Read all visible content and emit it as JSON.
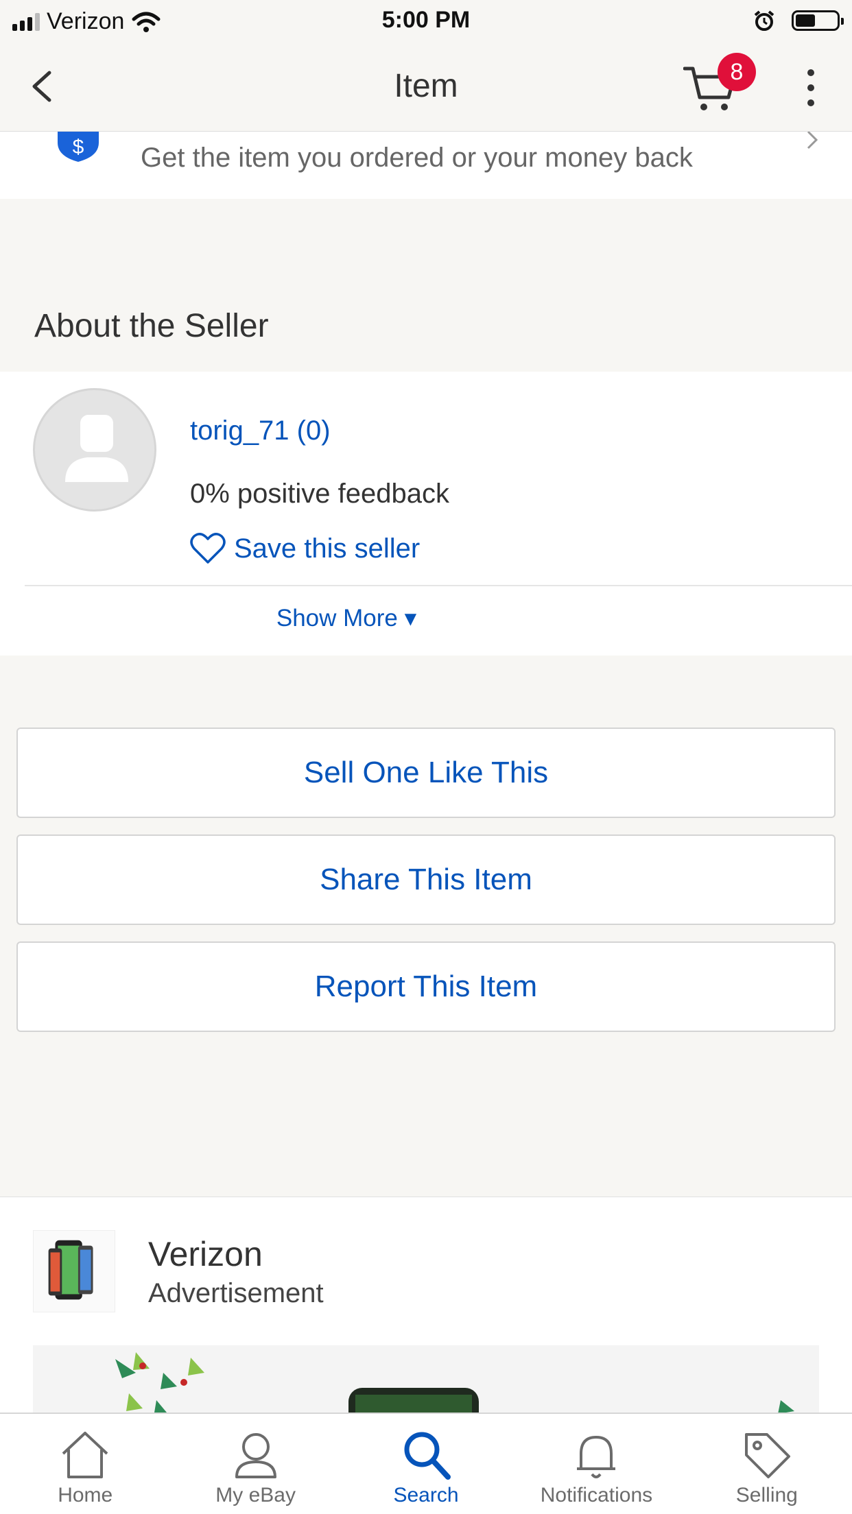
{
  "status_bar": {
    "carrier": "Verizon",
    "time": "5:00 PM"
  },
  "nav": {
    "title": "Item",
    "cart_count": "8"
  },
  "guarantee": {
    "text": "Get the item you ordered or your money back"
  },
  "about": {
    "heading": "About the Seller",
    "seller_name": "torig_71 (0)",
    "feedback": "0% positive feedback",
    "save_label": "Save this seller",
    "show_more": "Show More ▾"
  },
  "actions": {
    "sell": "Sell One Like This",
    "share": "Share This Item",
    "report": "Report This Item"
  },
  "ad": {
    "brand": "Verizon",
    "label": "Advertisement"
  },
  "tabs": [
    {
      "label": "Home",
      "icon": "home-icon"
    },
    {
      "label": "My eBay",
      "icon": "person-icon"
    },
    {
      "label": "Search",
      "icon": "search-icon",
      "active": true
    },
    {
      "label": "Notifications",
      "icon": "bell-icon"
    },
    {
      "label": "Selling",
      "icon": "tag-icon"
    }
  ],
  "colors": {
    "link": "#0654ba",
    "badge": "#e0103a",
    "background": "#f7f6f3"
  }
}
